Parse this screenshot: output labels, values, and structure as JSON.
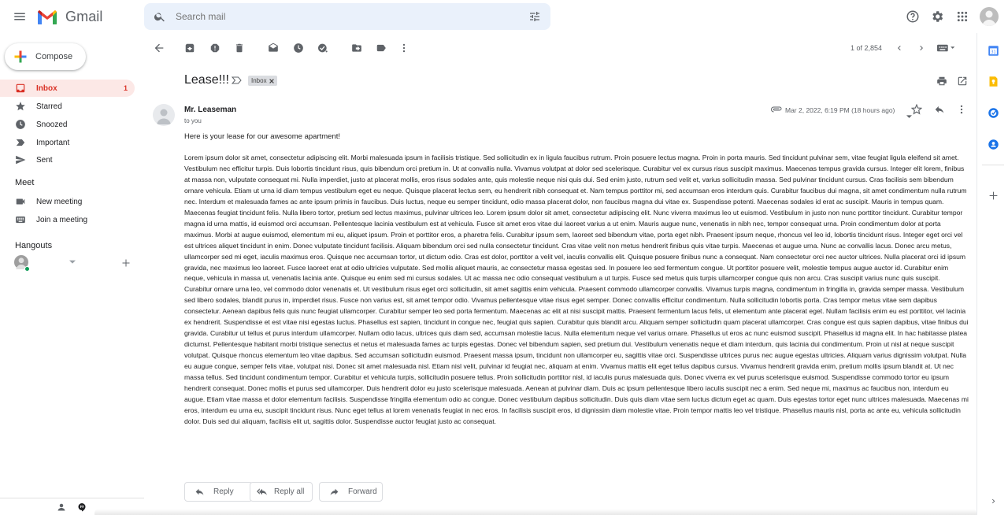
{
  "app": {
    "name": "Gmail"
  },
  "search": {
    "placeholder": "Search mail"
  },
  "sidebar": {
    "compose_label": "Compose",
    "items": [
      {
        "label": "Inbox",
        "count": "1",
        "icon": "inbox-icon"
      },
      {
        "label": "Starred",
        "icon": "star-icon"
      },
      {
        "label": "Snoozed",
        "icon": "clock-icon"
      },
      {
        "label": "Important",
        "icon": "important-icon"
      },
      {
        "label": "Sent",
        "icon": "send-icon"
      }
    ],
    "meet": {
      "title": "Meet",
      "items": [
        {
          "label": "New meeting",
          "icon": "video-icon"
        },
        {
          "label": "Join a meeting",
          "icon": "keyboard-icon"
        }
      ]
    },
    "hangouts": {
      "title": "Hangouts"
    }
  },
  "toolbar": {
    "pager": "1 of 2,854"
  },
  "email": {
    "subject": "Lease!!!",
    "label": "Inbox",
    "sender": "Mr. Leaseman",
    "to": "to you",
    "date": "Mar 2, 2022, 6:19 PM (18 hours ago)",
    "intro": "Here is your lease for our awesome apartment!",
    "body": "Lorem ipsum dolor sit amet, consectetur adipiscing elit. Morbi malesuada ipsum in facilisis tristique. Sed sollicitudin ex in ligula faucibus rutrum. Proin posuere lectus magna. Proin in porta mauris. Sed tincidunt pulvinar sem, vitae feugiat ligula eleifend sit amet. Vestibulum nec efficitur turpis. Duis lobortis tincidunt risus, quis bibendum orci pretium in. Ut at convallis nulla. Vivamus volutpat at dolor sed scelerisque. Curabitur vel ex cursus risus suscipit maximus. Maecenas tempus gravida cursus. Integer elit lorem, finibus at massa non, vulputate consequat mi. Nulla imperdiet, justo at placerat mollis, eros risus sodales ante, quis molestie neque nisi quis dui. Sed enim justo, rutrum sed velit et, varius sollicitudin massa. Sed pulvinar tincidunt cursus. Cras facilisis sem bibendum ornare vehicula. Etiam ut urna id diam tempus vestibulum eget eu neque. Quisque placerat lectus sem, eu hendrerit nibh consequat et. Nam tempus porttitor mi, sed accumsan eros interdum quis. Curabitur faucibus dui magna, sit amet condimentum nulla rutrum nec. Interdum et malesuada fames ac ante ipsum primis in faucibus. Duis luctus, neque eu semper tincidunt, odio massa placerat dolor, non faucibus magna dui vitae ex. Suspendisse potenti. Maecenas sodales id erat ac suscipit. Mauris in tempus quam. Maecenas feugiat tincidunt felis. Nulla libero tortor, pretium sed lectus maximus, pulvinar ultrices leo. Lorem ipsum dolor sit amet, consectetur adipiscing elit. Nunc viverra maximus leo ut euismod. Vestibulum in justo non nunc porttitor tincidunt. Curabitur tempor magna id urna mattis, id euismod orci accumsan. Pellentesque lacinia vestibulum est at vehicula. Fusce sit amet eros vitae dui laoreet varius a ut enim. Mauris augue nunc, venenatis in nibh nec, tempor consequat urna. Proin condimentum dolor at porta maximus. Morbi at augue euismod, elementum mi eu, aliquet ipsum. Proin et porttitor eros, a pharetra felis. Curabitur ipsum sem, laoreet sed bibendum vitae, porta eget nibh. Praesent ipsum neque, rhoncus vel leo id, lobortis tincidunt risus. Integer eget orci vel est ultrices aliquet tincidunt in enim. Donec vulputate tincidunt facilisis. Aliquam bibendum orci sed nulla consectetur tincidunt. Cras vitae velit non metus hendrerit finibus quis vitae turpis. Maecenas et augue urna. Nunc ac convallis lacus. Donec arcu metus, ullamcorper sed mi eget, iaculis maximus eros. Quisque nec accumsan tortor, ut dictum odio. Cras est dolor, porttitor a velit vel, iaculis convallis elit. Quisque posuere finibus nunc a consequat. Nam consectetur orci nec auctor ultrices. Nulla placerat orci id ipsum gravida, nec maximus leo laoreet. Fusce laoreet erat at odio ultricies vulputate. Sed mollis aliquet mauris, ac consectetur massa egestas sed. In posuere leo sed fermentum congue. Ut porttitor posuere velit, molestie tempus augue auctor id. Curabitur enim neque, vehicula in massa ut, venenatis lacinia ante. Quisque eu enim sed mi cursus sodales. Ut ac massa nec odio consequat vestibulum a ut turpis. Fusce sed metus quis turpis ullamcorper congue quis non arcu. Cras suscipit varius nunc quis suscipit. Curabitur ornare urna leo, vel commodo dolor venenatis et. Ut vestibulum risus eget orci sollicitudin, sit amet sagittis enim vehicula. Praesent commodo ullamcorper convallis. Vivamus turpis magna, condimentum in fringilla in, gravida semper massa. Vestibulum sed libero sodales, blandit purus in, imperdiet risus. Fusce non varius est, sit amet tempor odio. Vivamus pellentesque vitae risus eget semper. Donec convallis efficitur condimentum. Nulla sollicitudin lobortis porta. Cras tempor metus vitae sem dapibus consectetur. Aenean dapibus felis quis nunc feugiat ullamcorper. Curabitur semper leo sed porta fermentum. Maecenas ac elit at nisi suscipit mattis. Praesent fermentum lacus felis, ut elementum ante placerat eget. Nullam facilisis enim eu est porttitor, vel lacinia ex hendrerit. Suspendisse et est vitae nisi egestas luctus. Phasellus est sapien, tincidunt in congue nec, feugiat quis sapien. Curabitur quis blandit arcu. Aliquam semper sollicitudin quam placerat ullamcorper. Cras congue est quis sapien dapibus, vitae finibus dui gravida. Curabitur ut tellus et purus interdum ullamcorper. Nullam odio lacus, ultrices quis diam sed, accumsan molestie lacus. Nulla elementum neque vel varius ornare. Phasellus ut eros ac nunc euismod suscipit. Phasellus id magna elit. In hac habitasse platea dictumst. Pellentesque habitant morbi tristique senectus et netus et malesuada fames ac turpis egestas. Donec vel bibendum sapien, sed pretium dui. Vestibulum venenatis neque et diam interdum, quis lacinia dui condimentum. Proin ut nisl at neque suscipit volutpat. Quisque rhoncus elementum leo vitae dapibus. Sed accumsan sollicitudin euismod. Praesent massa ipsum, tincidunt non ullamcorper eu, sagittis vitae orci. Suspendisse ultrices purus nec augue egestas ultricies. Aliquam varius dignissim volutpat. Nulla eu augue congue, semper felis vitae, volutpat nisi. Donec sit amet malesuada nisl. Etiam nisl velit, pulvinar id feugiat nec, aliquam at enim. Vivamus mattis elit eget tellus dapibus cursus. Vivamus hendrerit gravida enim, pretium mollis ipsum blandit at. Ut nec massa tellus. Sed tincidunt condimentum tempor. Curabitur et vehicula turpis, sollicitudin posuere tellus. Proin sollicitudin porttitor nisl, id iaculis purus malesuada quis. Donec viverra ex vel purus scelerisque euismod. Suspendisse commodo tortor eu ipsum hendrerit consequat. Donec mollis et purus sed ullamcorper. Duis hendrerit dolor eu justo scelerisque malesuada. Aenean at pulvinar diam. Duis ac ipsum pellentesque libero iaculis suscipit nec a enim. Sed neque mi, maximus ac faucibus non, interdum eu augue. Etiam vitae massa et dolor elementum facilisis. Suspendisse fringilla elementum odio ac congue. Donec vestibulum dapibus sollicitudin. Duis quis diam vitae sem luctus dictum eget ac quam. Duis egestas tortor eget nunc ultrices malesuada. Maecenas mi eros, interdum eu urna eu, suscipit tincidunt risus. Nunc eget tellus at lorem venenatis feugiat in nec eros. In facilisis suscipit eros, id dignissim diam molestie vitae. Proin tempor mattis leo vel tristique. Phasellus mauris nisl, porta ac ante eu, vehicula sollicitudin dolor. Duis sed dui aliquam, facilisis elit ut, sagittis dolor. Suspendisse auctor feugiat justo ac consequat."
  },
  "actions": {
    "reply": "Reply",
    "reply_all": "Reply all",
    "forward": "Forward"
  },
  "colors": {
    "accent_red": "#d93025",
    "inbox_active_bg": "#fce8e6",
    "search_bg": "#eaf1fb"
  }
}
